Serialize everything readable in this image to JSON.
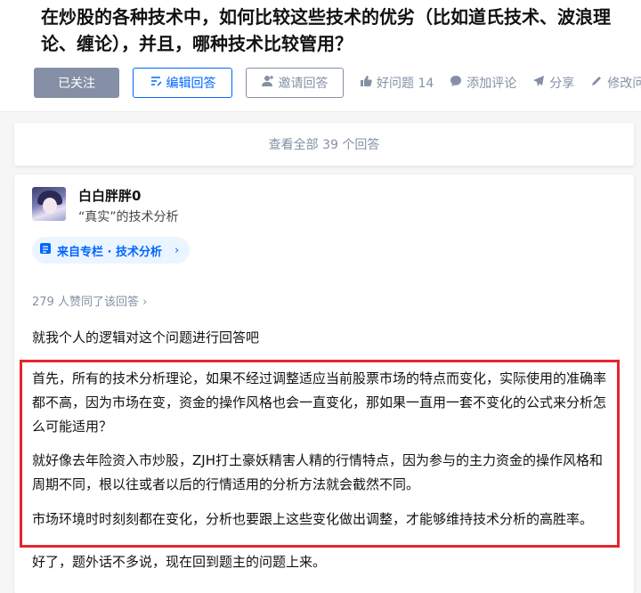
{
  "question": {
    "title": "在炒股的各种技术中，如何比较这些技术的优劣（比如道氏技术、波浪理论、缠论），并且，哪种技术比较管用？"
  },
  "actions": {
    "follow_label": "已关注",
    "edit_label": "编辑回答",
    "invite_label": "邀请回答",
    "good_question_label": "好问题 14",
    "comment_label": "添加评论",
    "share_label": "分享",
    "modify_label": "修改问"
  },
  "view_all": {
    "label": "查看全部 39 个回答"
  },
  "answer": {
    "author_name": "白白胖胖0",
    "author_bio": "“真实”的技术分析",
    "column_label": "来自专栏 · 技术分析",
    "column_chevron": "›",
    "voters_label": "279 人赞同了该回答 ›",
    "intro": "就我个人的逻辑对这个问题进行回答吧",
    "paragraph_1": "首先，所有的技术分析理论，如果不经过调整适应当前股票市场的特点而变化，实际使用的准确率都不高，因为市场在变，资金的操作风格也会一直变化，那如果一直用一套不变化的公式来分析怎么可能适用？",
    "paragraph_2": "就好像去年险资入市炒股，ZJH打土豪妖精害人精的行情特点，因为参与的主力资金的操作风格和周期不同，根以往或者以后的行情适用的分析方法就会截然不同。",
    "paragraph_3": "市场环境时时刻刻都在变化，分析也要跟上这些变化做出调整，才能够维持技术分析的高胜率。",
    "outro": "好了，题外话不多说，现在回到题主的问题上来。"
  },
  "colors": {
    "brand_blue": "#0066ff",
    "muted_gray": "#8590a6",
    "highlight_red": "#e2262e"
  }
}
